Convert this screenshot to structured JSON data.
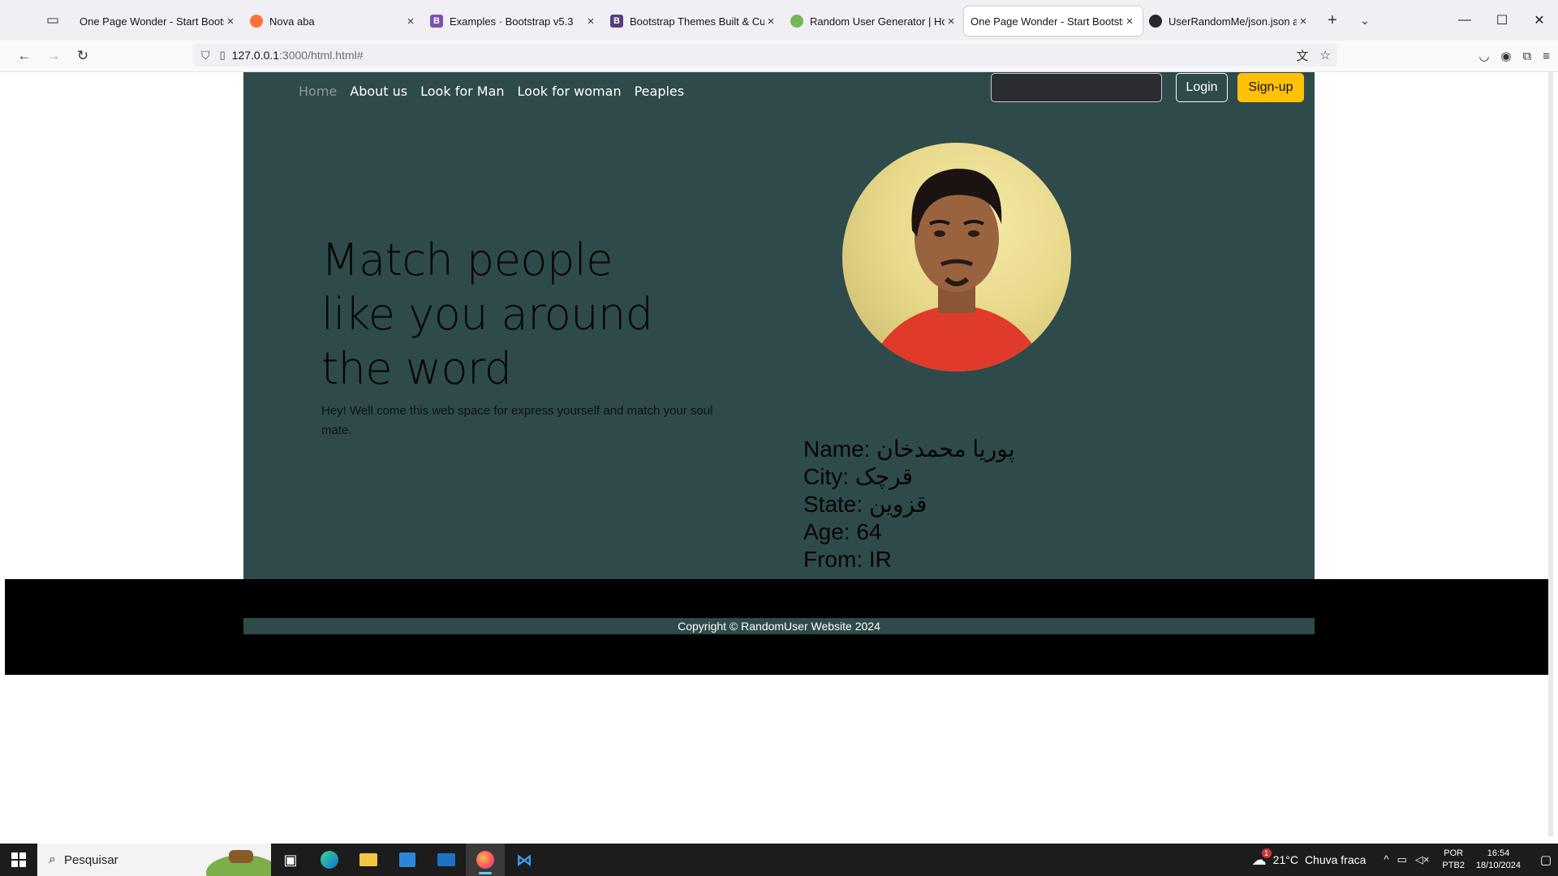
{
  "browser": {
    "tabs": [
      {
        "title": "One Page Wonder - Start Bootstrap",
        "fav_color": "#2d2d2d",
        "fav_glyph": ""
      },
      {
        "title": "Nova aba",
        "fav_color": "#ff7139",
        "fav_glyph": ""
      },
      {
        "title": "Examples · Bootstrap v5.3",
        "fav_color": "#7952b3",
        "fav_glyph": "B"
      },
      {
        "title": "Bootstrap Themes Built & Curated",
        "fav_color": "#563d7c",
        "fav_glyph": "B"
      },
      {
        "title": "Random User Generator | Home",
        "fav_color": "#77b55a",
        "fav_glyph": ""
      },
      {
        "title": "One Page Wonder - Start Bootstrap",
        "fav_color": "",
        "fav_glyph": ""
      },
      {
        "title": "UserRandomMe/json.json at main",
        "fav_color": "#24292f",
        "fav_glyph": ""
      }
    ],
    "url_host": "127.0.0.1",
    "url_path": ":3000/html.html#"
  },
  "site": {
    "nav": {
      "home": "Home",
      "about": "About us",
      "look_man": "Look for Man",
      "look_woman": "Look for woman",
      "peaples": "Peaples"
    },
    "login_label": "Login",
    "signup_label": "Sign-up",
    "hero_title": "Match people like you around the word",
    "hero_text": "Hey! Well come this web space for express yourself and match your soul mate.",
    "user": {
      "name": "Name: پوریا محمدخان",
      "city": "City: قرچک",
      "state": "State: قزوین",
      "age": "Age: 64",
      "from": "From: IR"
    },
    "footer": "Copyright © RandomUser Website 2024"
  },
  "taskbar": {
    "search_placeholder": "Pesquisar",
    "weather_temp": "21°C",
    "weather_text": "Chuva fraca",
    "weather_badge": "1",
    "lang_line1": "POR",
    "lang_line2": "PTB2",
    "time": "16:54",
    "date": "18/10/2024"
  }
}
